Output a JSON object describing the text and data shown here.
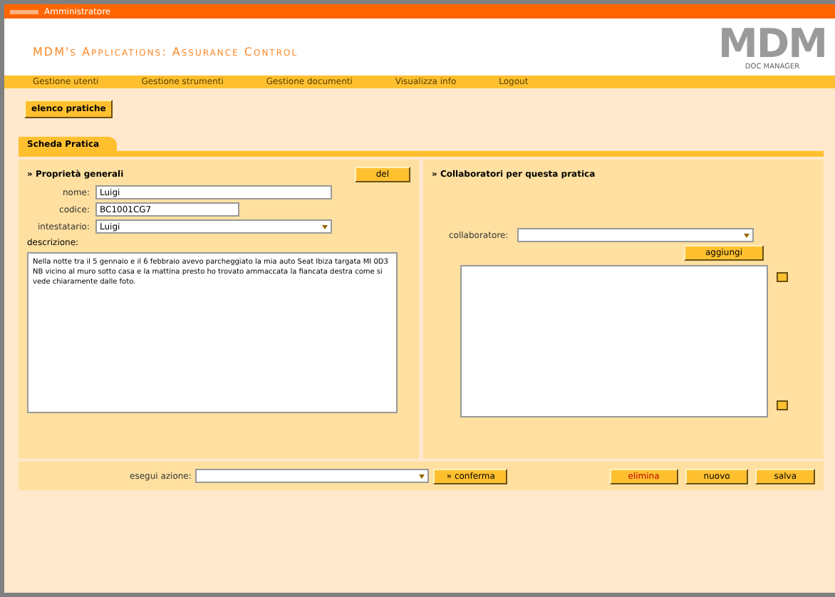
{
  "top_bar": {
    "user": "Amministratore"
  },
  "header": {
    "title": "MDM's Applications: Assurance Control",
    "logo": {
      "text": "MDM",
      "subtitle": "DOC MANAGER"
    }
  },
  "menu": [
    "Gestione utenti",
    "Gestione strumenti",
    "Gestione documenti",
    "Visualizza info",
    "Logout"
  ],
  "list_button": "elenco pratiche",
  "tab": {
    "label": "Scheda Pratica",
    "selected": true
  },
  "general": {
    "title": "» Proprietà generali",
    "button": "del",
    "fields": [
      {
        "label": "nome:",
        "kind": "text",
        "value": "Luigi"
      },
      {
        "label": "codice:",
        "kind": "short",
        "value": "BC1001CG7"
      },
      {
        "label": "intestatario:",
        "kind": "select",
        "value": "Luigi"
      }
    ],
    "description_label": "descrizione:",
    "description": "Nella notte tra il 5 gennaio e il 6 febbraio avevo parcheggiato la mia auto Seat Ibiza targata MI 0D3 NB vicino al muro sotto casa e la mattina presto ho trovato ammaccata la fiancata destra come si vede chiaramente dalle foto."
  },
  "collaborators": {
    "title": "» Collaboratori per questa pratica",
    "label": "collaboratore:",
    "button": "aggiungi"
  },
  "actions": {
    "label": "esegui azione:",
    "confirm": "» conferma",
    "buttons": [
      {
        "label": "elimina",
        "kind": "danger"
      },
      {
        "label": "nuovo",
        "kind": "normal"
      },
      {
        "label": "salva",
        "kind": "normal"
      }
    ]
  }
}
